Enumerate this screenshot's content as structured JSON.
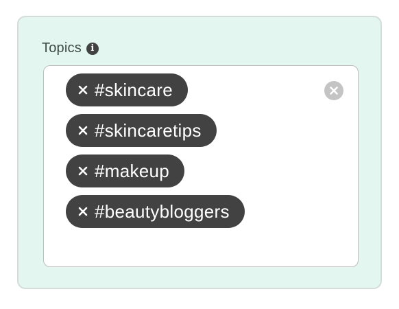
{
  "field": {
    "label": "Topics",
    "info_icon": "info-icon",
    "info_glyph": "i"
  },
  "tags": [
    {
      "label": "#skincare"
    },
    {
      "label": "#skincaretips"
    },
    {
      "label": "#makeup"
    },
    {
      "label": "#beautybloggers"
    }
  ],
  "icons": {
    "remove_tag": "close-icon",
    "clear_all": "clear-all-icon"
  },
  "colors": {
    "panel_background": "#e3f6ef",
    "chip_background": "#424242",
    "chip_text": "#ffffff",
    "clear_button": "#c4c4c4"
  }
}
